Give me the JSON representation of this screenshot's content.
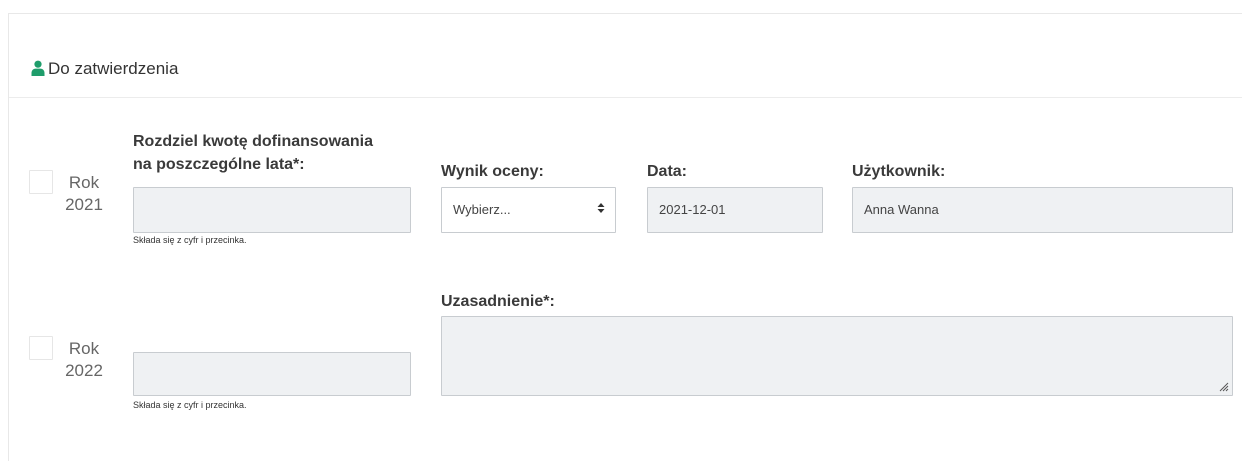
{
  "panel": {
    "title": "Do zatwierdzenia",
    "icon": "user-icon"
  },
  "rows": [
    {
      "year_word": "Rok",
      "year_number": "2021",
      "checked": false,
      "amount_value": "",
      "amount_help": "Składa się z cyfr i przecinka."
    },
    {
      "year_word": "Rok",
      "year_number": "2022",
      "checked": false,
      "amount_value": "",
      "amount_help": "Składa się z cyfr i przecinka."
    }
  ],
  "labels": {
    "amount_line1": "Rozdziel kwotę dofinansowania",
    "amount_line2": "na poszczególne lata*:",
    "result": "Wynik oceny:",
    "date": "Data:",
    "user": "Użytkownik:",
    "justification": "Uzasadnienie*:"
  },
  "fields": {
    "result_selected": "Wybierz...",
    "date_value": "2021-12-01",
    "user_value": "Anna Wanna",
    "justification_value": ""
  },
  "colors": {
    "icon": "#1f9d6b",
    "input_bg": "#eff1f3",
    "border": "#c8ccd0"
  }
}
